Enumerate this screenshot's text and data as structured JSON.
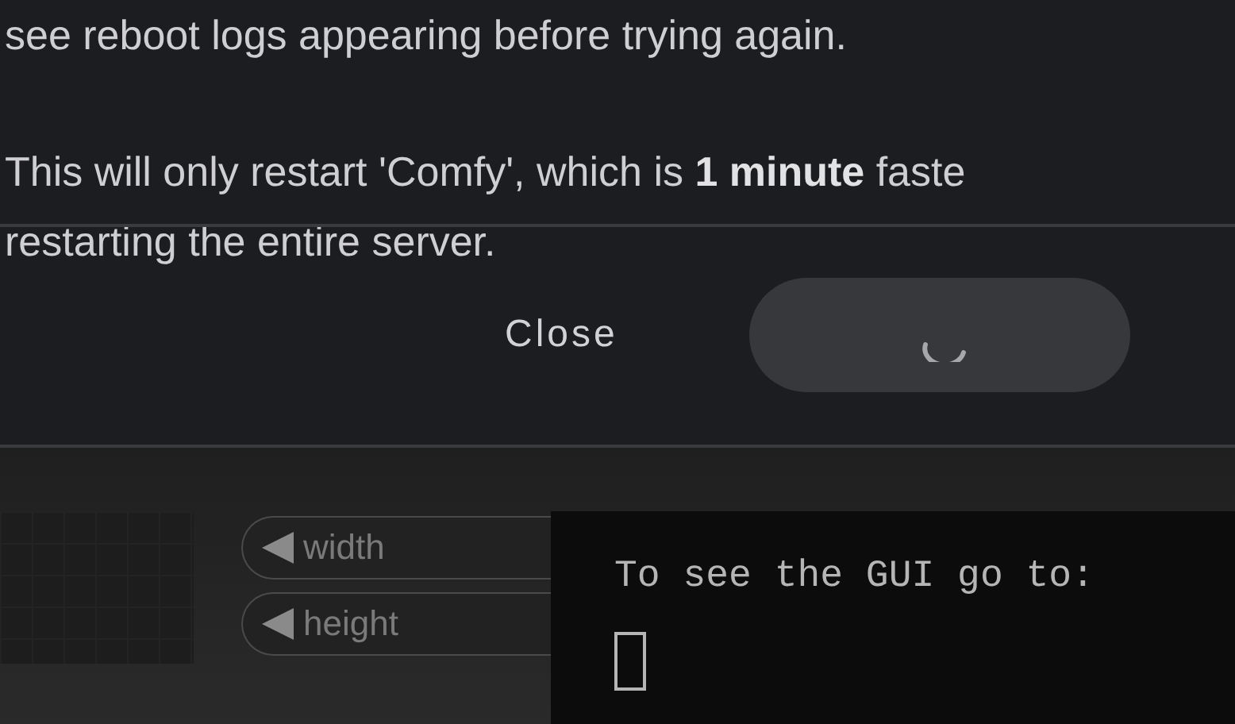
{
  "dialog": {
    "paragraphs": [
      [
        "see reboot logs appearing before trying again."
      ],
      [
        "This will only restart 'Comfy', which is **1 minute** faste",
        "restarting the entire server."
      ]
    ],
    "buttons": [
      {
        "kind": "text",
        "label": "Close"
      },
      {
        "kind": "loading"
      }
    ]
  },
  "node": {
    "inputs": [
      "width",
      "height"
    ]
  },
  "terminal": {
    "lines": [
      "To see the GUI go to:"
    ]
  }
}
